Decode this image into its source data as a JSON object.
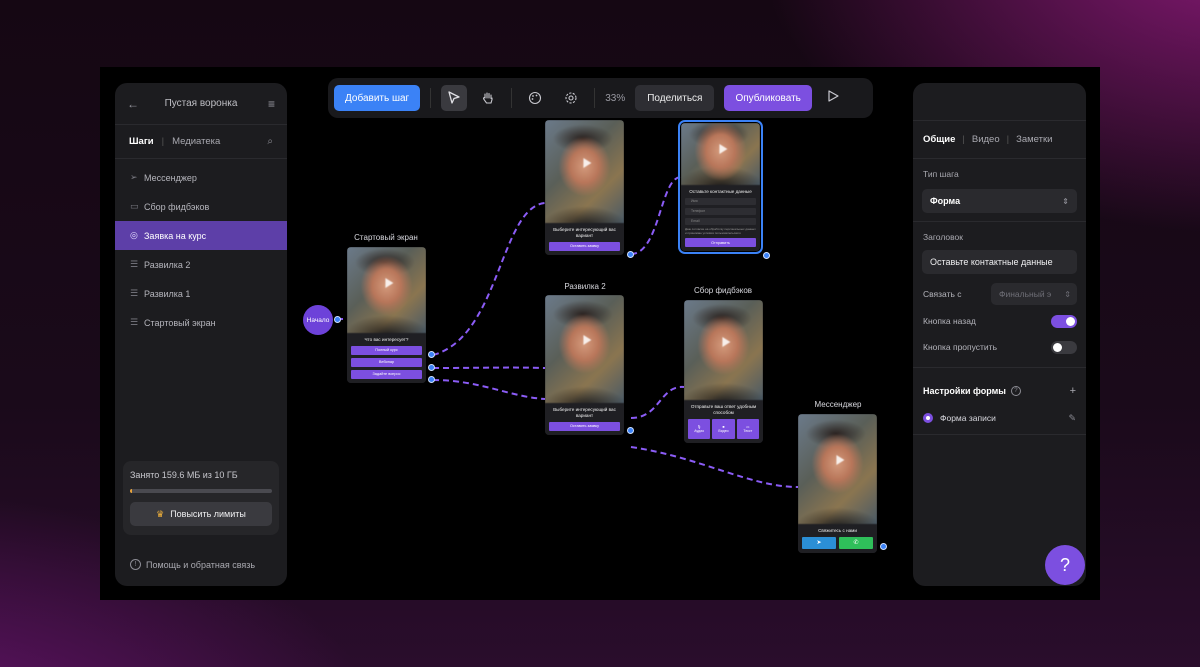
{
  "left_panel": {
    "title": "Пустая воронка",
    "tabs": [
      "Шаги",
      "Медиатека"
    ],
    "items": [
      {
        "label": "Мессенджер",
        "icon": "send-icon",
        "active": false
      },
      {
        "label": "Сбор фидбэков",
        "icon": "message-icon",
        "active": false
      },
      {
        "label": "Заявка на курс",
        "icon": "target-icon",
        "active": true
      },
      {
        "label": "Развилка 2",
        "icon": "list-icon",
        "active": false
      },
      {
        "label": "Развилка 1",
        "icon": "list-icon",
        "active": false
      },
      {
        "label": "Стартовый экран",
        "icon": "list-icon",
        "active": false
      }
    ],
    "storage_text": "Занято 159.6 МБ из 10 ГБ",
    "storage_fraction": 0.016,
    "upgrade_label": "Повысить лимиты",
    "help_label": "Помощь и обратная связь"
  },
  "toolbar": {
    "add_step": "Добавить шаг",
    "zoom": "33%",
    "share": "Поделиться",
    "publish": "Опубликовать"
  },
  "canvas": {
    "start_label": "Начало",
    "nodes": {
      "start_screen": {
        "title": "Стартовый экран",
        "question": "Что вас интересует?",
        "options": [
          "Полный курс",
          "Вебинар",
          "Задайте вопрос"
        ]
      },
      "fork1": {
        "question": "Выберите интересующий вас вариант",
        "button": "Оставить заявку"
      },
      "course_form": {
        "question": "Оставьте контактные данные",
        "fields": [
          "Имя",
          "Телефон",
          "Email"
        ],
        "consent": "Даю согласие на обработку персональных данных и принимаю условия пользовательского",
        "submit": "Отправить"
      },
      "fork2": {
        "title": "Развилка 2",
        "question": "Выберите интересующий вас вариант",
        "button": "Оставить заявку"
      },
      "feedback": {
        "title": "Сбор фидбэков",
        "question": "Отправьте ваш ответ удобным способом",
        "options": [
          "Аудио",
          "Видео",
          "Текст"
        ]
      },
      "messenger": {
        "title": "Мессенджер",
        "question": "Свяжитесь с нами"
      }
    }
  },
  "right_panel": {
    "tabs": [
      "Общие",
      "Видео",
      "Заметки"
    ],
    "step_type_label": "Тип шага",
    "step_type_value": "Форма",
    "heading_label": "Заголовок",
    "heading_value": "Оставьте контактные данные",
    "link_label": "Связать с",
    "link_value": "Финальный э",
    "back_button_label": "Кнопка назад",
    "back_button_on": true,
    "skip_button_label": "Кнопка пропустить",
    "skip_button_on": false,
    "form_settings_label": "Настройки формы",
    "form_item": "Форма записи"
  },
  "colors": {
    "accent": "#7c4fe0",
    "primary_blue": "#3b82f6",
    "panel": "#1c1c1f"
  }
}
